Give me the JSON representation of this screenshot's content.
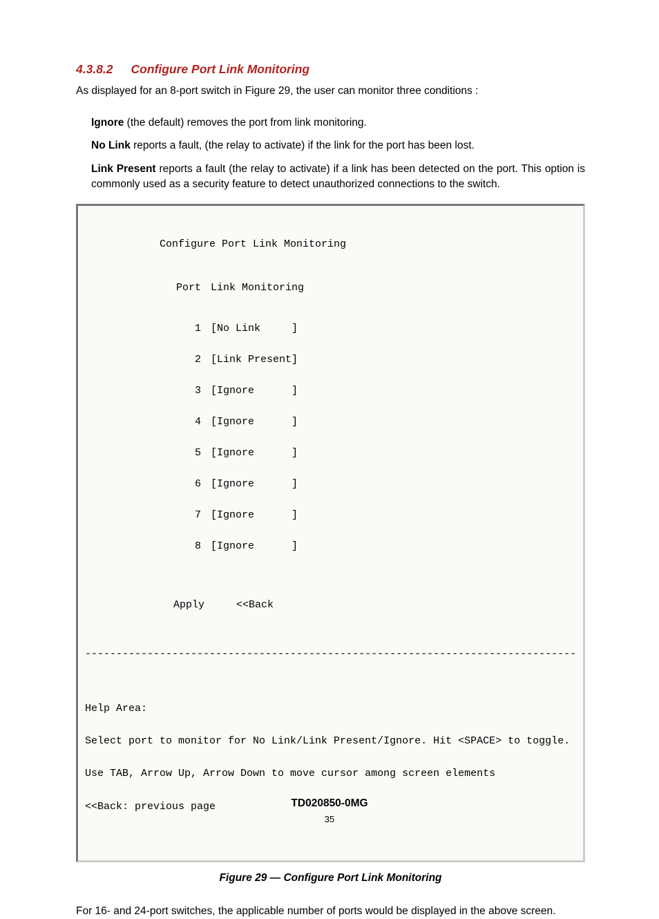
{
  "heading": {
    "number": "4.3.8.2",
    "title": "Configure Port Link Monitoring"
  },
  "intro": "As displayed for an 8-port switch in Figure 29, the user can monitor three conditions :",
  "definitions": [
    {
      "term": "Ignore",
      "desc": " (the default) removes the port from link monitoring."
    },
    {
      "term": "No Link",
      "desc": " reports a fault, (the relay to activate) if the link for the port has been lost."
    },
    {
      "term": "Link Present",
      "desc": "  reports a fault (the relay to activate) if a link has been detected on the port.  This option is commonly used as a security feature to detect unauthorized connections to the switch."
    }
  ],
  "terminal": {
    "title": "Configure Port Link Monitoring",
    "col_port": "Port",
    "col_mode": "Link Monitoring",
    "rows": [
      {
        "port": "1",
        "mode": "[No Link     ]"
      },
      {
        "port": "2",
        "mode": "[Link Present]"
      },
      {
        "port": "3",
        "mode": "[Ignore      ]"
      },
      {
        "port": "4",
        "mode": "[Ignore      ]"
      },
      {
        "port": "5",
        "mode": "[Ignore      ]"
      },
      {
        "port": "6",
        "mode": "[Ignore      ]"
      },
      {
        "port": "7",
        "mode": "[Ignore      ]"
      },
      {
        "port": "8",
        "mode": "[Ignore      ]"
      }
    ],
    "apply": "Apply",
    "back": "<<Back",
    "divider": "-------------------------------------------------------------------------------",
    "help_label": "Help Area:",
    "help_line1": "Select port to monitor for No Link/Link Present/Ignore. Hit <SPACE> to toggle.",
    "help_line2": "Use TAB, Arrow Up, Arrow Down to move cursor among screen elements",
    "help_line3": "<<Back: previous page"
  },
  "figure_caption": "Figure 29 — Configure Port Link Monitoring",
  "after_note": "For 16- and 24-port switches, the applicable number of ports would be displayed in the above screen.",
  "footer_doc": "TD020850-0MG",
  "footer_page": "35"
}
